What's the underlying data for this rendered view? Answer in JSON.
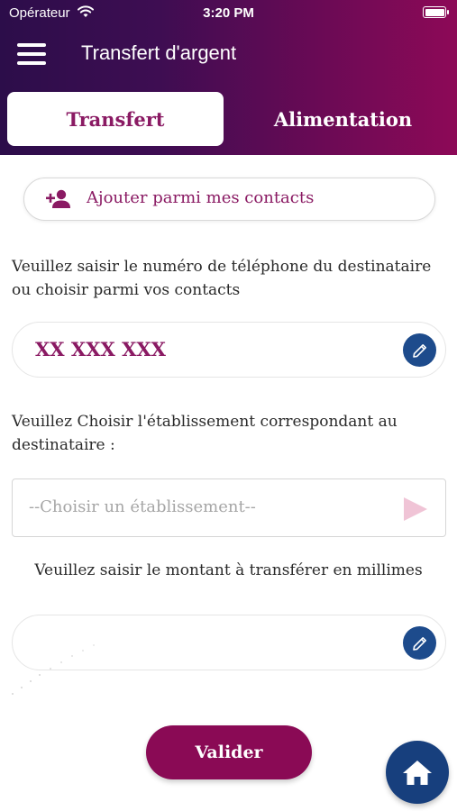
{
  "status_bar": {
    "carrier": "Opérateur",
    "time": "3:20 PM"
  },
  "header": {
    "title": "Transfert d'argent",
    "menu_icon": "hamburger-menu-icon"
  },
  "tabs": [
    {
      "label": "Transfert",
      "active": true
    },
    {
      "label": "Alimentation",
      "active": false
    }
  ],
  "contacts_button": {
    "label": "Ajouter parmi mes contacts",
    "icon": "add-person-icon"
  },
  "phone_section": {
    "instruction": "Veuillez saisir le numéro de téléphone du destinataire ou choisir parmi vos contacts",
    "value": "XX XXX XXX",
    "edit_icon": "pencil-icon"
  },
  "institution_section": {
    "instruction": "Veuillez Choisir l'établissement correspondant au destinataire :",
    "placeholder": "--Choisir un établissement--",
    "arrow_icon": "triangle-right-icon"
  },
  "amount_section": {
    "instruction": "Veuillez saisir le montant à transférer en millimes",
    "value": "",
    "edit_icon": "pencil-icon"
  },
  "validate_button": {
    "label": "Valider"
  },
  "home_button": {
    "icon": "home-icon"
  },
  "colors": {
    "brand": "#8a1a63",
    "button": "#8a0a55",
    "blue": "#1d4b8c",
    "gradient_start": "#2c0d4a",
    "gradient_end": "#8d0957"
  }
}
